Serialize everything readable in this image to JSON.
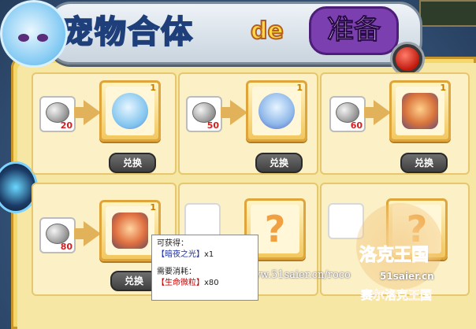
{
  "header": {
    "title_main": "宠物合体",
    "title_de": "de",
    "title_prep": "准备"
  },
  "exchange_items": [
    {
      "cost": "20",
      "qty": "1",
      "button": "兑换",
      "icon": "ghost-pet-icon"
    },
    {
      "cost": "50",
      "qty": "1",
      "button": "兑换",
      "icon": "lamp-item-icon"
    },
    {
      "cost": "60",
      "qty": "1",
      "button": "兑换",
      "icon": "book-item-icon"
    },
    {
      "cost": "80",
      "qty": "1",
      "button": "兑换",
      "icon": "scroll-item-icon"
    }
  ],
  "locked_items": [
    {
      "mark": "?"
    },
    {
      "mark": "?"
    }
  ],
  "tooltip": {
    "obtain_label": "可获得：",
    "obtain_item": "【暗夜之光】",
    "obtain_qty": "x1",
    "cost_label": "需要消耗：",
    "cost_item": "【生命微粒】",
    "cost_qty": "x80"
  },
  "watermark": {
    "url": "www.51saier.cn/roco",
    "brand": "洛克王国",
    "site": "51saier.cn",
    "slogan": "赛尔洛克王国"
  },
  "colors": {
    "price_red": "#d42020",
    "accent_orange": "#e0a53a",
    "panel_yellow": "#f4d86a"
  }
}
